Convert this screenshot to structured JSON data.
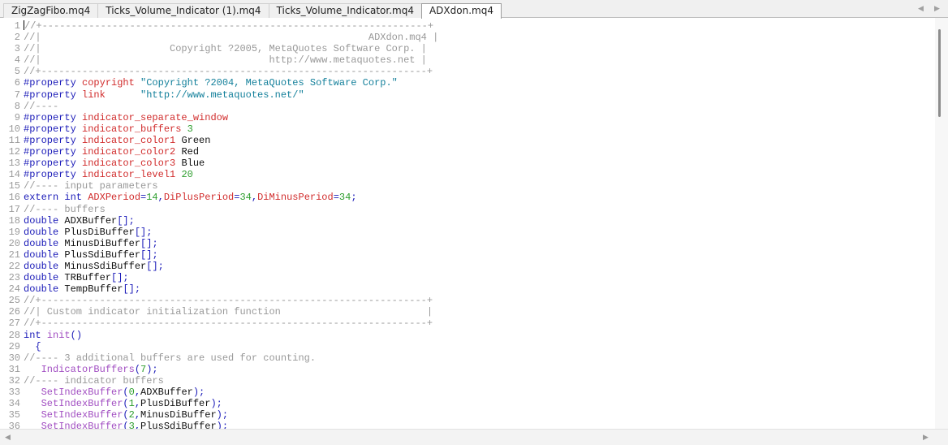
{
  "tabs": [
    {
      "label": "ZigZagFibo.mq4",
      "active": false
    },
    {
      "label": "Ticks_Volume_Indicator (1).mq4",
      "active": false
    },
    {
      "label": "Ticks_Volume_Indicator.mq4",
      "active": false
    },
    {
      "label": "ADXdon.mq4",
      "active": true
    }
  ],
  "tab_scroll": {
    "left": "◀",
    "right": "▶"
  },
  "scroll_arrows": {
    "left": "◀",
    "right": "▶"
  },
  "colors": {
    "keyword": "#1a1ab8",
    "property": "#d12c2c",
    "string": "#14809b",
    "number": "#2e9e2e",
    "comment": "#999999",
    "function": "#a24fc2"
  },
  "code": [
    {
      "n": "1",
      "caret": true,
      "t": [
        [
          "cmt",
          "//+------------------------------------------------------------------+"
        ]
      ]
    },
    {
      "n": "2",
      "t": [
        [
          "cmt",
          "//|                                                        ADXdon.mq4 |"
        ]
      ]
    },
    {
      "n": "3",
      "t": [
        [
          "cmt",
          "//|                      Copyright ?2005, MetaQuotes Software Corp. |"
        ]
      ]
    },
    {
      "n": "4",
      "t": [
        [
          "cmt",
          "//|                                       http://www.metaquotes.net |"
        ]
      ]
    },
    {
      "n": "5",
      "t": [
        [
          "cmt",
          "//+------------------------------------------------------------------+"
        ]
      ]
    },
    {
      "n": "6",
      "t": [
        [
          "kw",
          "#property "
        ],
        [
          "prop",
          "copyright "
        ],
        [
          "str",
          "\"Copyright ?2004, MetaQuotes Software Corp.\""
        ]
      ]
    },
    {
      "n": "7",
      "t": [
        [
          "kw",
          "#property "
        ],
        [
          "prop",
          "link      "
        ],
        [
          "str",
          "\"http://www.metaquotes.net/\""
        ]
      ]
    },
    {
      "n": "8",
      "t": [
        [
          "cmt",
          "//----"
        ]
      ]
    },
    {
      "n": "9",
      "t": [
        [
          "kw",
          "#property "
        ],
        [
          "prop",
          "indicator_separate_window"
        ]
      ]
    },
    {
      "n": "10",
      "t": [
        [
          "kw",
          "#property "
        ],
        [
          "prop",
          "indicator_buffers "
        ],
        [
          "num",
          "3"
        ]
      ]
    },
    {
      "n": "11",
      "t": [
        [
          "kw",
          "#property "
        ],
        [
          "prop",
          "indicator_color1 "
        ],
        [
          "plain",
          "Green"
        ]
      ]
    },
    {
      "n": "12",
      "t": [
        [
          "kw",
          "#property "
        ],
        [
          "prop",
          "indicator_color2 "
        ],
        [
          "plain",
          "Red"
        ]
      ]
    },
    {
      "n": "13",
      "t": [
        [
          "kw",
          "#property "
        ],
        [
          "prop",
          "indicator_color3 "
        ],
        [
          "plain",
          "Blue"
        ]
      ]
    },
    {
      "n": "14",
      "t": [
        [
          "kw",
          "#property "
        ],
        [
          "prop",
          "indicator_level1 "
        ],
        [
          "num",
          "20"
        ]
      ]
    },
    {
      "n": "15",
      "t": [
        [
          "cmt",
          "//---- input parameters"
        ]
      ]
    },
    {
      "n": "16",
      "t": [
        [
          "kw",
          "extern int "
        ],
        [
          "prop",
          "ADXPeriod"
        ],
        [
          "kw",
          "="
        ],
        [
          "num",
          "14"
        ],
        [
          "kw",
          ","
        ],
        [
          "prop",
          "DiPlusPeriod"
        ],
        [
          "kw",
          "="
        ],
        [
          "num",
          "34"
        ],
        [
          "kw",
          ","
        ],
        [
          "prop",
          "DiMinusPeriod"
        ],
        [
          "kw",
          "="
        ],
        [
          "num",
          "34"
        ],
        [
          "kw",
          ";"
        ]
      ]
    },
    {
      "n": "17",
      "t": [
        [
          "cmt",
          "//---- buffers"
        ]
      ]
    },
    {
      "n": "18",
      "t": [
        [
          "kw",
          "double "
        ],
        [
          "plain",
          "ADXBuffer"
        ],
        [
          "kw",
          "[];"
        ]
      ]
    },
    {
      "n": "19",
      "t": [
        [
          "kw",
          "double "
        ],
        [
          "plain",
          "PlusDiBuffer"
        ],
        [
          "kw",
          "[];"
        ]
      ]
    },
    {
      "n": "20",
      "t": [
        [
          "kw",
          "double "
        ],
        [
          "plain",
          "MinusDiBuffer"
        ],
        [
          "kw",
          "[];"
        ]
      ]
    },
    {
      "n": "21",
      "t": [
        [
          "kw",
          "double "
        ],
        [
          "plain",
          "PlusSdiBuffer"
        ],
        [
          "kw",
          "[];"
        ]
      ]
    },
    {
      "n": "22",
      "t": [
        [
          "kw",
          "double "
        ],
        [
          "plain",
          "MinusSdiBuffer"
        ],
        [
          "kw",
          "[];"
        ]
      ]
    },
    {
      "n": "23",
      "t": [
        [
          "kw",
          "double "
        ],
        [
          "plain",
          "TRBuffer"
        ],
        [
          "kw",
          "[];"
        ]
      ]
    },
    {
      "n": "24",
      "t": [
        [
          "kw",
          "double "
        ],
        [
          "plain",
          "TempBuffer"
        ],
        [
          "kw",
          "[];"
        ]
      ]
    },
    {
      "n": "25",
      "t": [
        [
          "cmt",
          "//+------------------------------------------------------------------+"
        ]
      ]
    },
    {
      "n": "26",
      "t": [
        [
          "cmt",
          "//| Custom indicator initialization function                         |"
        ]
      ]
    },
    {
      "n": "27",
      "t": [
        [
          "cmt",
          "//+------------------------------------------------------------------+"
        ]
      ]
    },
    {
      "n": "28",
      "t": [
        [
          "kw",
          "int "
        ],
        [
          "fn",
          "init"
        ],
        [
          "kw",
          "()"
        ]
      ]
    },
    {
      "n": "29",
      "t": [
        [
          "kw",
          "  {"
        ]
      ]
    },
    {
      "n": "30",
      "t": [
        [
          "cmt",
          "//---- 3 additional buffers are used for counting."
        ]
      ]
    },
    {
      "n": "31",
      "t": [
        [
          "fn",
          "   IndicatorBuffers"
        ],
        [
          "kw",
          "("
        ],
        [
          "num",
          "7"
        ],
        [
          "kw",
          ");"
        ]
      ]
    },
    {
      "n": "32",
      "t": [
        [
          "cmt",
          "//---- indicator buffers"
        ]
      ]
    },
    {
      "n": "33",
      "t": [
        [
          "fn",
          "   SetIndexBuffer"
        ],
        [
          "kw",
          "("
        ],
        [
          "num",
          "0"
        ],
        [
          "kw",
          ","
        ],
        [
          "plain",
          "ADXBuffer"
        ],
        [
          "kw",
          ");"
        ]
      ]
    },
    {
      "n": "34",
      "t": [
        [
          "fn",
          "   SetIndexBuffer"
        ],
        [
          "kw",
          "("
        ],
        [
          "num",
          "1"
        ],
        [
          "kw",
          ","
        ],
        [
          "plain",
          "PlusDiBuffer"
        ],
        [
          "kw",
          ");"
        ]
      ]
    },
    {
      "n": "35",
      "t": [
        [
          "fn",
          "   SetIndexBuffer"
        ],
        [
          "kw",
          "("
        ],
        [
          "num",
          "2"
        ],
        [
          "kw",
          ","
        ],
        [
          "plain",
          "MinusDiBuffer"
        ],
        [
          "kw",
          ");"
        ]
      ]
    },
    {
      "n": "36",
      "t": [
        [
          "fn",
          "   SetIndexBuffer"
        ],
        [
          "kw",
          "("
        ],
        [
          "num",
          "3"
        ],
        [
          "kw",
          ","
        ],
        [
          "plain",
          "PlusSdiBuffer"
        ],
        [
          "kw",
          ");"
        ]
      ]
    }
  ]
}
